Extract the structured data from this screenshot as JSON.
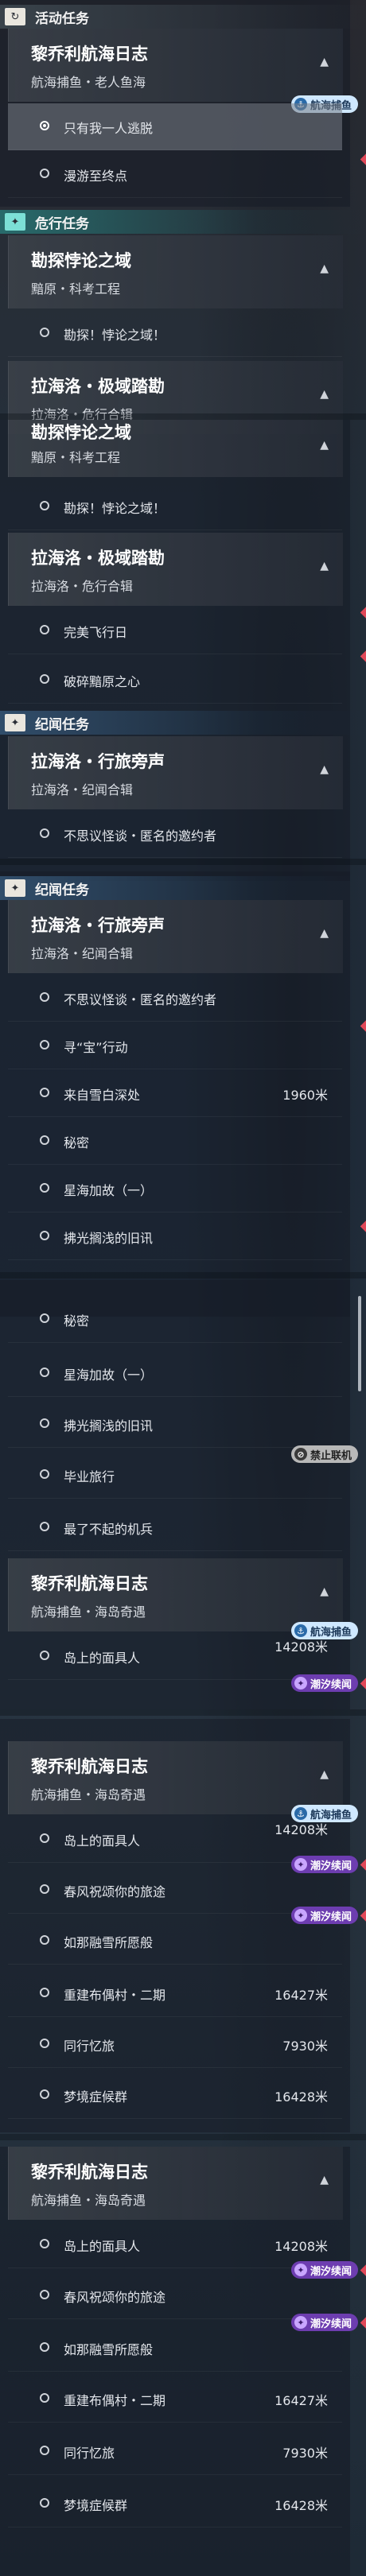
{
  "categories": {
    "active": "活动任务",
    "danger": "危行任务",
    "chronicle": "纪闻任务"
  },
  "cat_icons": {
    "active": "↻",
    "danger": "✦",
    "chronicle": "✦"
  },
  "heads": {
    "lichaoli": {
      "title": "黎乔利航海日志",
      "sub_old": "航海捕鱼・老人鱼海",
      "sub_isle": "航海捕鱼・海岛奇遇"
    },
    "kantan": {
      "title": "勘探悖论之域",
      "sub": "黯原・科考工程"
    },
    "lahailuo": {
      "title": "拉海洛・极域踏勘",
      "sub": "拉海洛・危行合辑"
    },
    "xinglv": {
      "title": "拉海洛・行旅旁声",
      "sub": "拉海洛・纪闻合辑"
    }
  },
  "items": {
    "escape": "只有我一人逃脱",
    "drift": "漫游至终点",
    "kantan_q": "勘探！悖论之域！",
    "flight": "完美飞行日",
    "break": "破碎黯原之心",
    "invite": "不思议怪谈・匿名的邀约者",
    "treasure": "寻“宝”行动",
    "snow": "来自雪白深处",
    "secret": "秘密",
    "stars": "星海加故（一）",
    "shallow": "拂光搁浅的旧讯",
    "graduate": "毕业旅行",
    "mecha": "最了不起的机兵",
    "mask": "岛上的面具人",
    "spring": "春风祝颂你的旅途",
    "camp": "如那融雪所愿般",
    "rebuild": "重建布偶村・二期",
    "memory": "同行忆旅",
    "dream": "梦境症候群"
  },
  "dist": {
    "snow": "1960米",
    "mask": "14208米",
    "rebuild": "16427米",
    "memory": "7930米",
    "dream": "16428米"
  },
  "badges": {
    "boat": "航海捕鱼",
    "tide": "潮汐续闻",
    "stop": "禁止联机"
  },
  "badge_icons": {
    "boat": "⚓",
    "tide": "✦",
    "stop": "⊘"
  },
  "ui": {
    "chevron": "▲",
    "chevron_down": "▼"
  }
}
